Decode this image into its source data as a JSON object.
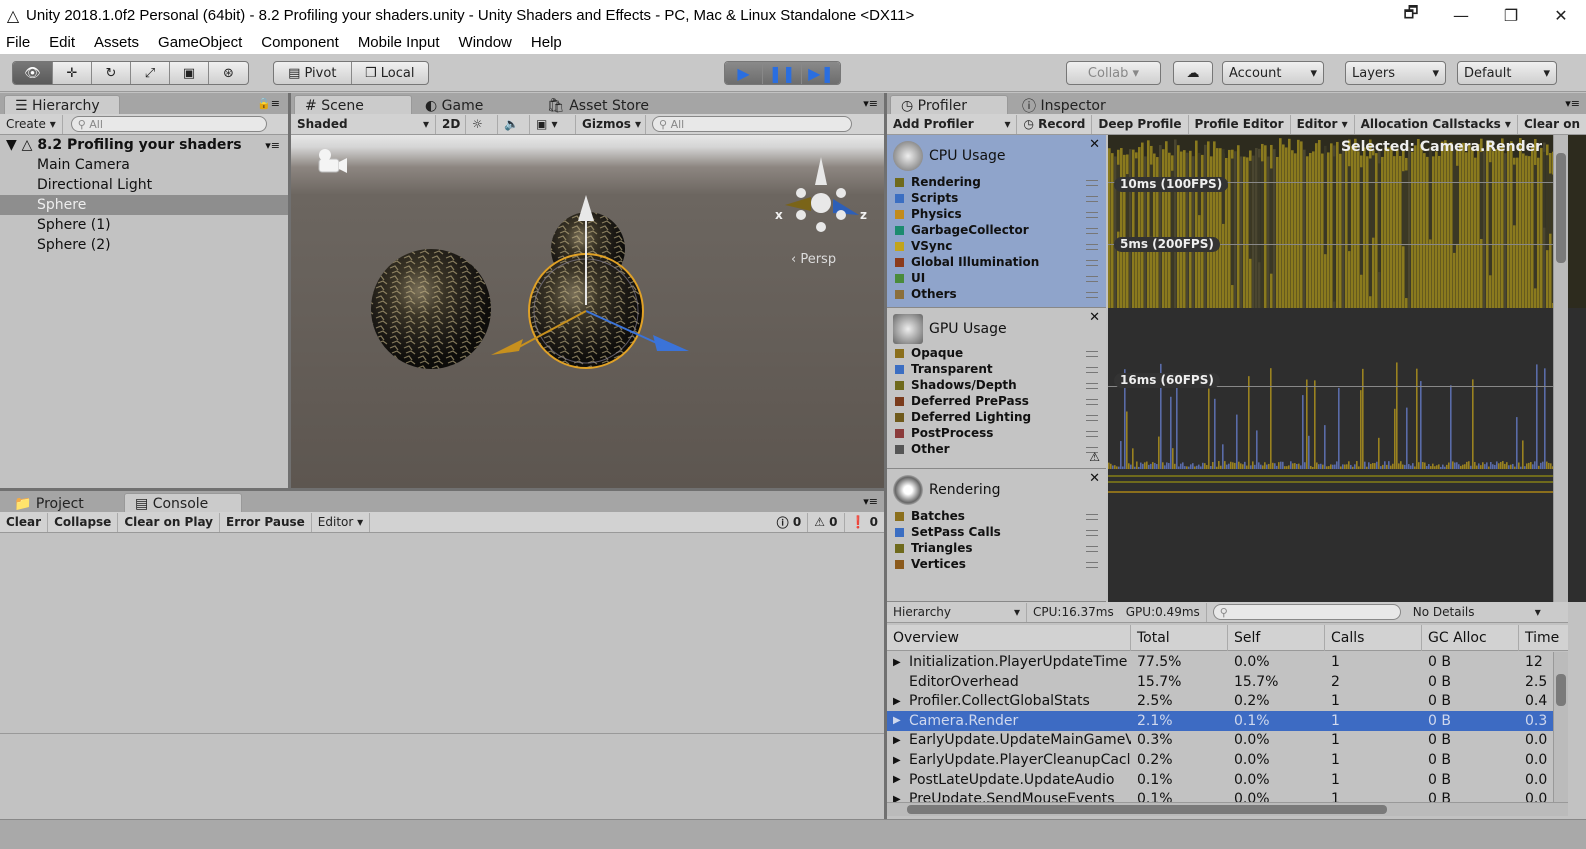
{
  "window": {
    "title": "Unity 2018.1.0f2 Personal (64bit) - 8.2 Profiling your shaders.unity - Unity Shaders and Effects - PC, Mac & Linux Standalone <DX11>",
    "controls": [
      "🗗",
      "—",
      "❐",
      "✕"
    ]
  },
  "menu": [
    "File",
    "Edit",
    "Assets",
    "GameObject",
    "Component",
    "Mobile Input",
    "Window",
    "Help"
  ],
  "toolbar": {
    "tools": [
      "👁",
      "✛",
      "↻",
      "⤢",
      "▣",
      "⊛"
    ],
    "pivot": "Pivot",
    "local": "Local",
    "play": [
      "▶",
      "❚❚",
      "▶❚"
    ],
    "collab": "Collab ▾",
    "cloud": "☁",
    "account": "Account",
    "layers": "Layers",
    "layout": "Default"
  },
  "hierarchy": {
    "tab": "Hierarchy",
    "create": "Create",
    "search_placeholder": "All",
    "scene_name": "8.2 Profiling your shaders",
    "items": [
      "Main Camera",
      "Directional Light",
      "Sphere",
      "Sphere (1)",
      "Sphere (2)"
    ],
    "selected_index": 2
  },
  "scene": {
    "tabs": [
      "Scene",
      "Game",
      "Asset Store"
    ],
    "shading": "Shaded",
    "mode_2d": "2D",
    "gizmos": "Gizmos",
    "search_placeholder": "All",
    "persp": "‹ Persp",
    "axis_x": "x",
    "axis_z": "z"
  },
  "console": {
    "tabs": [
      "Project",
      "Console"
    ],
    "buttons": [
      "Clear",
      "Collapse",
      "Clear on Play",
      "Error Pause",
      "Editor ▾"
    ],
    "counts": {
      "info": "0",
      "warn": "0",
      "error": "0"
    }
  },
  "profiler": {
    "tabs": [
      "Profiler",
      "Inspector"
    ],
    "toolbar": [
      "Add Profiler",
      "Record",
      "Deep Profile",
      "Profile Editor",
      "Editor",
      "Allocation Callstacks",
      "Clear on"
    ],
    "modules": [
      {
        "name": "CPU Usage",
        "items": [
          {
            "label": "Rendering",
            "color": "#6f6a1c"
          },
          {
            "label": "Scripts",
            "color": "#3b6ec2"
          },
          {
            "label": "Physics",
            "color": "#c28b1c"
          },
          {
            "label": "GarbageCollector",
            "color": "#1c8b6f"
          },
          {
            "label": "VSync",
            "color": "#c2a41c"
          },
          {
            "label": "Global Illumination",
            "color": "#8b3b1c"
          },
          {
            "label": "UI",
            "color": "#4a8b3b"
          },
          {
            "label": "Others",
            "color": "#8b6f3b"
          }
        ]
      },
      {
        "name": "GPU Usage",
        "items": [
          {
            "label": "Opaque",
            "color": "#8b6f1c"
          },
          {
            "label": "Transparent",
            "color": "#3b6ec2"
          },
          {
            "label": "Shadows/Depth",
            "color": "#6f6a1c"
          },
          {
            "label": "Deferred PrePass",
            "color": "#7a3b1c"
          },
          {
            "label": "Deferred Lighting",
            "color": "#6f5a1c"
          },
          {
            "label": "PostProcess",
            "color": "#8b3b3b"
          },
          {
            "label": "Other",
            "color": "#555555"
          }
        ]
      },
      {
        "name": "Rendering",
        "items": [
          {
            "label": "Batches",
            "color": "#8b6f1c"
          },
          {
            "label": "SetPass Calls",
            "color": "#3b6ec2"
          },
          {
            "label": "Triangles",
            "color": "#6f6a1c"
          },
          {
            "label": "Vertices",
            "color": "#8b5a1c"
          }
        ]
      }
    ],
    "cpu_graph": {
      "selected": "Selected: Camera.Render",
      "line1": "10ms (100FPS)",
      "line2": "5ms (200FPS)"
    },
    "gpu_graph": {
      "line1": "16ms (60FPS)"
    },
    "details_bar": {
      "view": "Hierarchy",
      "cpu": "CPU:16.37ms",
      "gpu": "GPU:0.49ms",
      "details": "No Details"
    },
    "columns": [
      "Overview",
      "Total",
      "Self",
      "Calls",
      "GC Alloc",
      "Time"
    ],
    "rows": [
      {
        "expand": "▶",
        "name": "Initialization.PlayerUpdateTime",
        "total": "77.5%",
        "self": "0.0%",
        "calls": "1",
        "gc": "0 B",
        "time": "12"
      },
      {
        "expand": "",
        "name": "EditorOverhead",
        "total": "15.7%",
        "self": "15.7%",
        "calls": "2",
        "gc": "0 B",
        "time": "2.5"
      },
      {
        "expand": "▶",
        "name": "Profiler.CollectGlobalStats",
        "total": "2.5%",
        "self": "0.2%",
        "calls": "1",
        "gc": "0 B",
        "time": "0.4"
      },
      {
        "expand": "▶",
        "name": "Camera.Render",
        "total": "2.1%",
        "self": "0.1%",
        "calls": "1",
        "gc": "0 B",
        "time": "0.3"
      },
      {
        "expand": "▶",
        "name": "EarlyUpdate.UpdateMainGameV",
        "total": "0.3%",
        "self": "0.0%",
        "calls": "1",
        "gc": "0 B",
        "time": "0.0"
      },
      {
        "expand": "▶",
        "name": "EarlyUpdate.PlayerCleanupCacl",
        "total": "0.2%",
        "self": "0.0%",
        "calls": "1",
        "gc": "0 B",
        "time": "0.0"
      },
      {
        "expand": "▶",
        "name": "PostLateUpdate.UpdateAudio",
        "total": "0.1%",
        "self": "0.0%",
        "calls": "1",
        "gc": "0 B",
        "time": "0.0"
      },
      {
        "expand": "▶",
        "name": "PreUpdate.SendMouseEvents",
        "total": "0.1%",
        "self": "0.0%",
        "calls": "1",
        "gc": "0 B",
        "time": "0.0"
      }
    ],
    "selected_row": 3
  }
}
